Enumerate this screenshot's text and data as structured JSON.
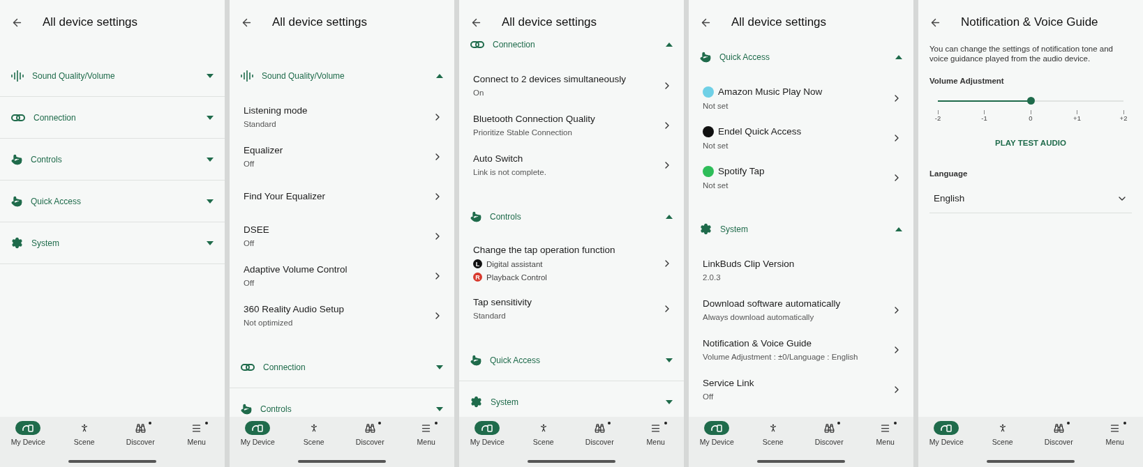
{
  "screens": [
    {
      "kind": "list",
      "title": "All device settings",
      "items": [
        {
          "kind": "sound_section",
          "label": "Sound Quality/Volume",
          "expanded": false
        },
        {
          "kind": "connection_section",
          "label": "Connection",
          "expanded": false
        },
        {
          "kind": "controls_section",
          "label": "Controls",
          "expanded": false
        },
        {
          "kind": "quick_section",
          "label": "Quick Access",
          "expanded": false
        },
        {
          "kind": "system_section",
          "label": "System",
          "expanded": false
        }
      ],
      "nav": [
        {
          "label": "My Device",
          "selected": true,
          "dot": false
        },
        {
          "label": "Scene",
          "selected": false,
          "dot": false
        },
        {
          "label": "Discover",
          "selected": false,
          "dot": true
        },
        {
          "label": "Menu",
          "selected": false,
          "dot": true
        }
      ]
    },
    {
      "kind": "list",
      "title": "All device settings",
      "items": [
        {
          "kind": "sound_section",
          "label": "Sound Quality/Volume",
          "expanded": true
        },
        {
          "kind": "setting",
          "title": "Listening mode",
          "value": "Standard"
        },
        {
          "kind": "setting",
          "title": "Equalizer",
          "value": "Off"
        },
        {
          "kind": "setting",
          "title": "Find Your Equalizer"
        },
        {
          "kind": "setting",
          "title": "DSEE",
          "value": "Off"
        },
        {
          "kind": "setting",
          "title": "Adaptive Volume Control",
          "value": "Off"
        },
        {
          "kind": "setting",
          "title": "360 Reality Audio Setup",
          "value": "Not optimized"
        },
        {
          "kind": "connection_section",
          "label": "Connection",
          "expanded": false
        },
        {
          "kind": "controls_section",
          "label": "Controls",
          "expanded": false
        }
      ],
      "nav": [
        {
          "label": "My Device",
          "selected": true,
          "dot": false
        },
        {
          "label": "Scene",
          "selected": false,
          "dot": false
        },
        {
          "label": "Discover",
          "selected": false,
          "dot": true
        },
        {
          "label": "Menu",
          "selected": false,
          "dot": true
        }
      ]
    },
    {
      "kind": "list",
      "title": "All device settings",
      "items": [
        {
          "kind": "connection_section",
          "label": "Connection",
          "expanded": true
        },
        {
          "kind": "setting",
          "title": "Connect to 2 devices simultaneously",
          "value": "On"
        },
        {
          "kind": "setting",
          "title": "Bluetooth Connection Quality",
          "value": "Prioritize Stable Connection"
        },
        {
          "kind": "setting",
          "title": "Auto Switch",
          "value": "Link is not complete."
        },
        {
          "kind": "controls_section",
          "label": "Controls",
          "expanded": true
        },
        {
          "kind": "assignment",
          "title": "Change the tap operation function",
          "sides": [
            {
              "badge": "L",
              "color": "#111111",
              "text": "Digital assistant"
            },
            {
              "badge": "R",
              "color": "#d83a2e",
              "text": "Playback Control"
            }
          ]
        },
        {
          "kind": "setting",
          "title": "Tap sensitivity",
          "value": "Standard"
        },
        {
          "kind": "quick_section",
          "label": "Quick Access",
          "expanded": false
        },
        {
          "kind": "system_section",
          "label": "System",
          "expanded": false
        }
      ],
      "nav": [
        {
          "label": "My Device",
          "selected": true,
          "dot": false
        },
        {
          "label": "Scene",
          "selected": false,
          "dot": false
        },
        {
          "label": "Discover",
          "selected": false,
          "dot": true
        },
        {
          "label": "Menu",
          "selected": false,
          "dot": true
        }
      ]
    },
    {
      "kind": "list",
      "title": "All device settings",
      "items": [
        {
          "kind": "quick_section",
          "label": "Quick Access",
          "expanded": true
        },
        {
          "kind": "app",
          "title": "Amazon Music Play Now",
          "value": "Not set",
          "color": "#6fd0e6"
        },
        {
          "kind": "app",
          "title": "Endel Quick Access",
          "value": "Not set",
          "color": "#111111"
        },
        {
          "kind": "app",
          "title": "Spotify Tap",
          "value": "Not set",
          "color": "#2ebd59"
        },
        {
          "kind": "system_section",
          "label": "System",
          "expanded": true
        },
        {
          "kind": "info",
          "title": "LinkBuds Clip Version",
          "value": "2.0.3"
        },
        {
          "kind": "setting",
          "title": "Download software automatically",
          "value": "Always download automatically"
        },
        {
          "kind": "setting",
          "title": "Notification & Voice Guide",
          "value": "Volume Adjustment : ±0/Language : English"
        },
        {
          "kind": "setting",
          "title": "Service Link",
          "value": "Off"
        }
      ],
      "nav": [
        {
          "label": "My Device",
          "selected": true,
          "dot": false
        },
        {
          "label": "Scene",
          "selected": false,
          "dot": false
        },
        {
          "label": "Discover",
          "selected": false,
          "dot": true
        },
        {
          "label": "Menu",
          "selected": false,
          "dot": true
        }
      ]
    },
    {
      "kind": "guide",
      "title": "Notification & Voice Guide",
      "description": "You can change the settings of notification tone and voice guidance played from the audio device.",
      "volume": {
        "label": "Volume Adjustment",
        "level": 0.5,
        "ticks": [
          "-2",
          "-1",
          "0",
          "+1",
          "+2"
        ]
      },
      "test_button": "PLAY TEST AUDIO",
      "language": {
        "label": "Language",
        "value": "English"
      },
      "nav": [
        {
          "label": "My Device",
          "selected": true,
          "dot": false
        },
        {
          "label": "Scene",
          "selected": false,
          "dot": false
        },
        {
          "label": "Discover",
          "selected": false,
          "dot": true
        },
        {
          "label": "Menu",
          "selected": false,
          "dot": true
        }
      ]
    }
  ]
}
